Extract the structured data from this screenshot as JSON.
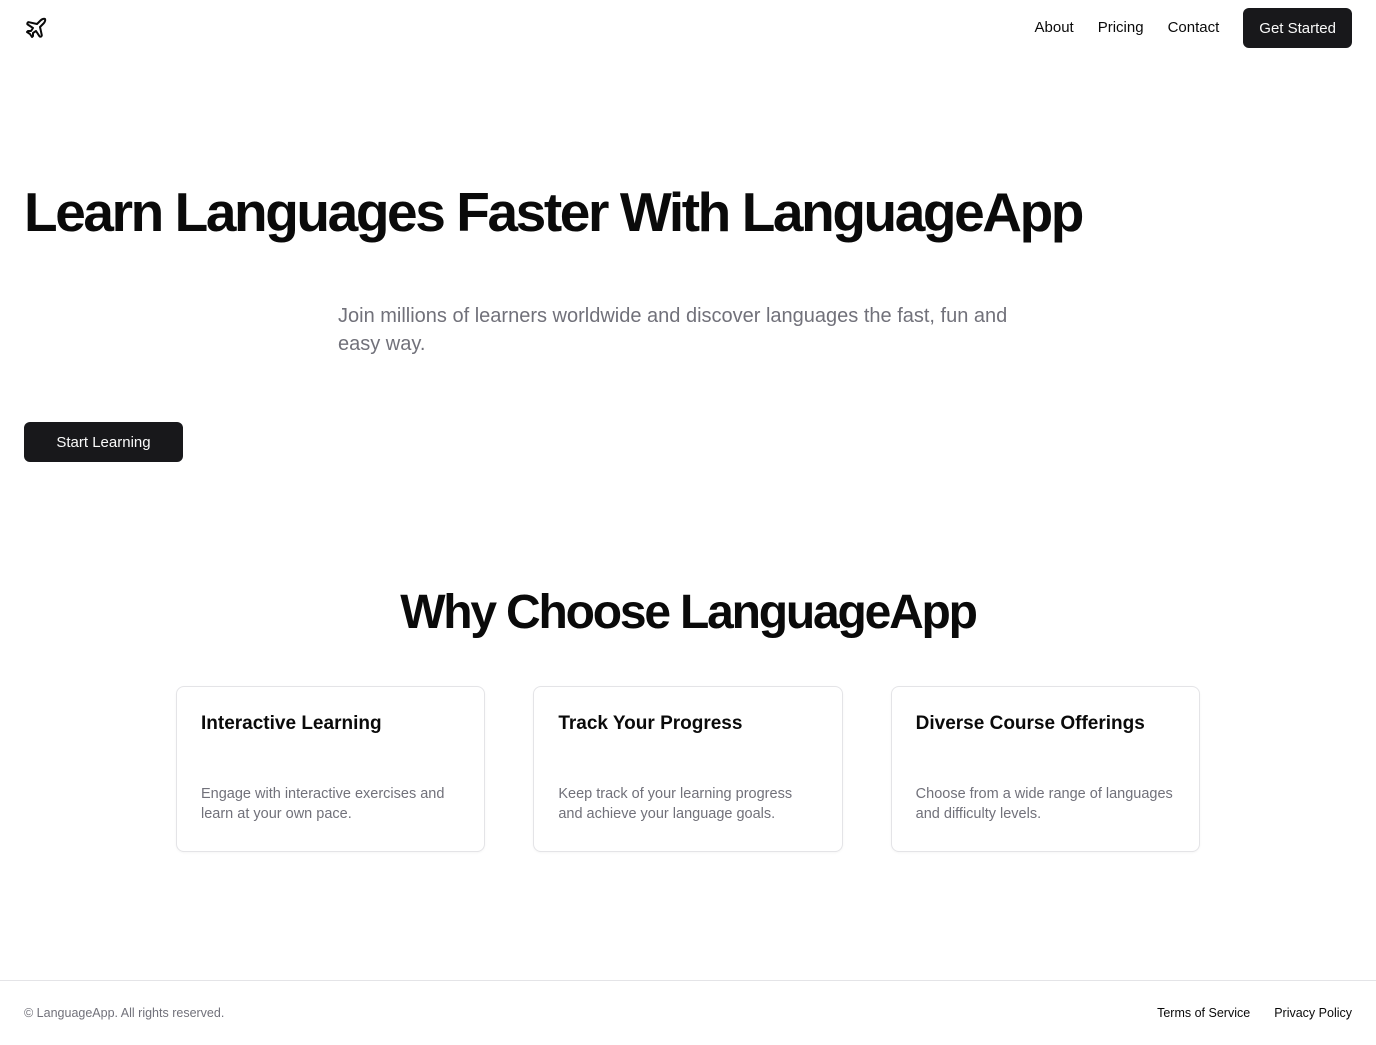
{
  "header": {
    "logo_icon": "plane-icon",
    "nav": [
      {
        "label": "About"
      },
      {
        "label": "Pricing"
      },
      {
        "label": "Contact"
      }
    ],
    "cta_label": "Get Started"
  },
  "hero": {
    "title": "Learn Languages Faster With LanguageApp",
    "subtitle": "Join millions of learners worldwide and discover languages the fast, fun and easy way.",
    "cta_label": "Start Learning"
  },
  "features": {
    "title": "Why Choose LanguageApp",
    "cards": [
      {
        "title": "Interactive Learning",
        "description": "Engage with interactive exercises and learn at your own pace."
      },
      {
        "title": "Track Your Progress",
        "description": "Keep track of your learning progress and achieve your language goals."
      },
      {
        "title": "Diverse Course Offerings",
        "description": "Choose from a wide range of languages and difficulty levels."
      }
    ]
  },
  "footer": {
    "copyright": "© LanguageApp. All rights reserved.",
    "links": [
      {
        "label": "Terms of Service"
      },
      {
        "label": "Privacy Policy"
      }
    ]
  },
  "colors": {
    "primary_button": "#18181b",
    "muted_text": "#71717a",
    "border": "#e4e4e7"
  }
}
